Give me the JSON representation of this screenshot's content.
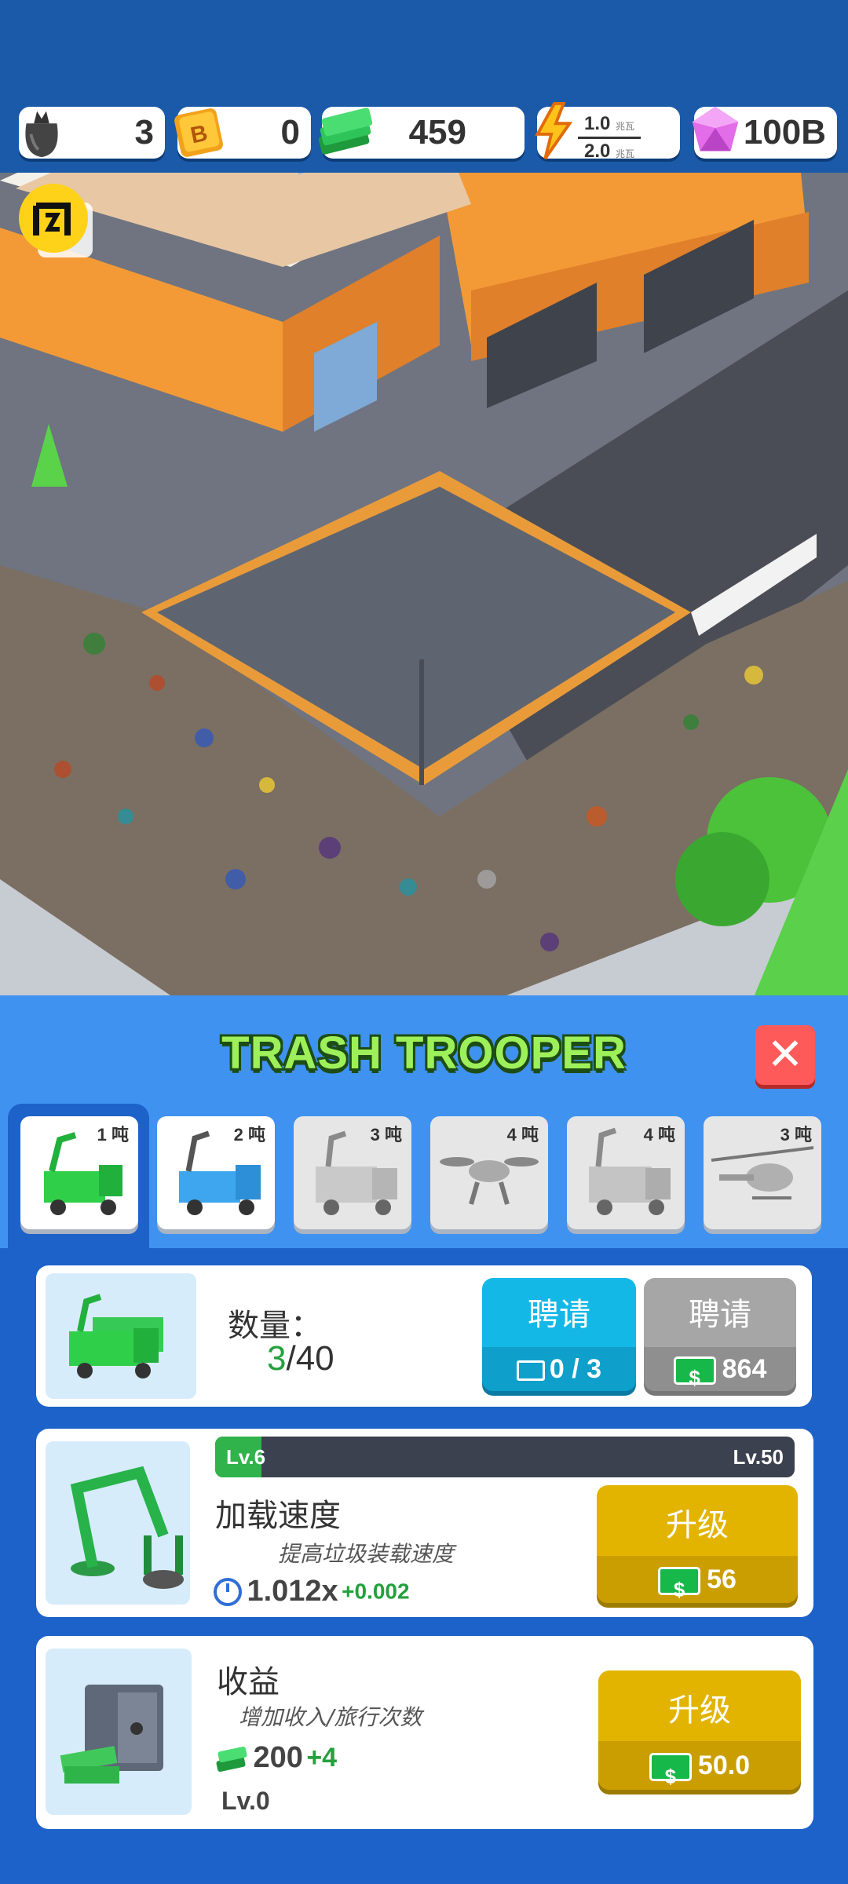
{
  "resources": {
    "trash_bags": "3",
    "b_coins": "0",
    "cash": "459",
    "power_top": "1.0",
    "power_top_unit": "兆瓦",
    "power_bottom": "2.0",
    "power_bottom_unit": "兆瓦",
    "gems": "100B"
  },
  "icons": [
    "trash-bag-icon",
    "b-coin-icon",
    "cash-stack-icon",
    "lightning-icon",
    "gem-icon",
    "flash-logo-icon",
    "cash-icon",
    "video-icon",
    "timer-icon"
  ],
  "panel": {
    "title": "TRASH TROOPER",
    "close_label": "✕",
    "tabs": [
      {
        "capacity": "1 吨",
        "state": "selected",
        "vehicle": "green-garbage-truck"
      },
      {
        "capacity": "2 吨",
        "state": "available",
        "vehicle": "blue-garbage-truck"
      },
      {
        "capacity": "3 吨",
        "state": "locked",
        "vehicle": "grey-truck"
      },
      {
        "capacity": "4 吨",
        "state": "locked",
        "vehicle": "drone"
      },
      {
        "capacity": "4 吨",
        "state": "locked",
        "vehicle": "grey-crane-truck"
      },
      {
        "capacity": "3 吨",
        "state": "locked",
        "vehicle": "helicopter"
      }
    ]
  },
  "hire": {
    "quantity_label": "数量：",
    "quantity_current": "3",
    "quantity_max": "/40",
    "hire_video_label": "聘请",
    "hire_video_count": "0 / 3",
    "hire_cash_label": "聘请",
    "hire_cash_price": "864"
  },
  "loading_speed": {
    "title": "加载速度",
    "description": "提高垃圾装载速度",
    "level_current": "Lv.6",
    "level_max": "Lv.50",
    "level_fraction": 0.08,
    "value": "1.012x",
    "increment": "+0.002",
    "upgrade_label": "升级",
    "upgrade_price": "56"
  },
  "income": {
    "title": "收益",
    "description": "增加收入/旅行次数",
    "value": "200",
    "increment": "+4",
    "level": "Lv.0",
    "upgrade_label": "升级",
    "upgrade_price": "50.0"
  },
  "colors": {
    "top_bar": "#1a5aa8",
    "panel": "#3f92f0",
    "lower_panel": "#1d62c9",
    "hire_video": "#14b8e6",
    "hire_cash": "#a6a6a6",
    "upgrade": "#e2b400",
    "level_fill": "#2fb34a",
    "close": "#ff5a5a"
  }
}
